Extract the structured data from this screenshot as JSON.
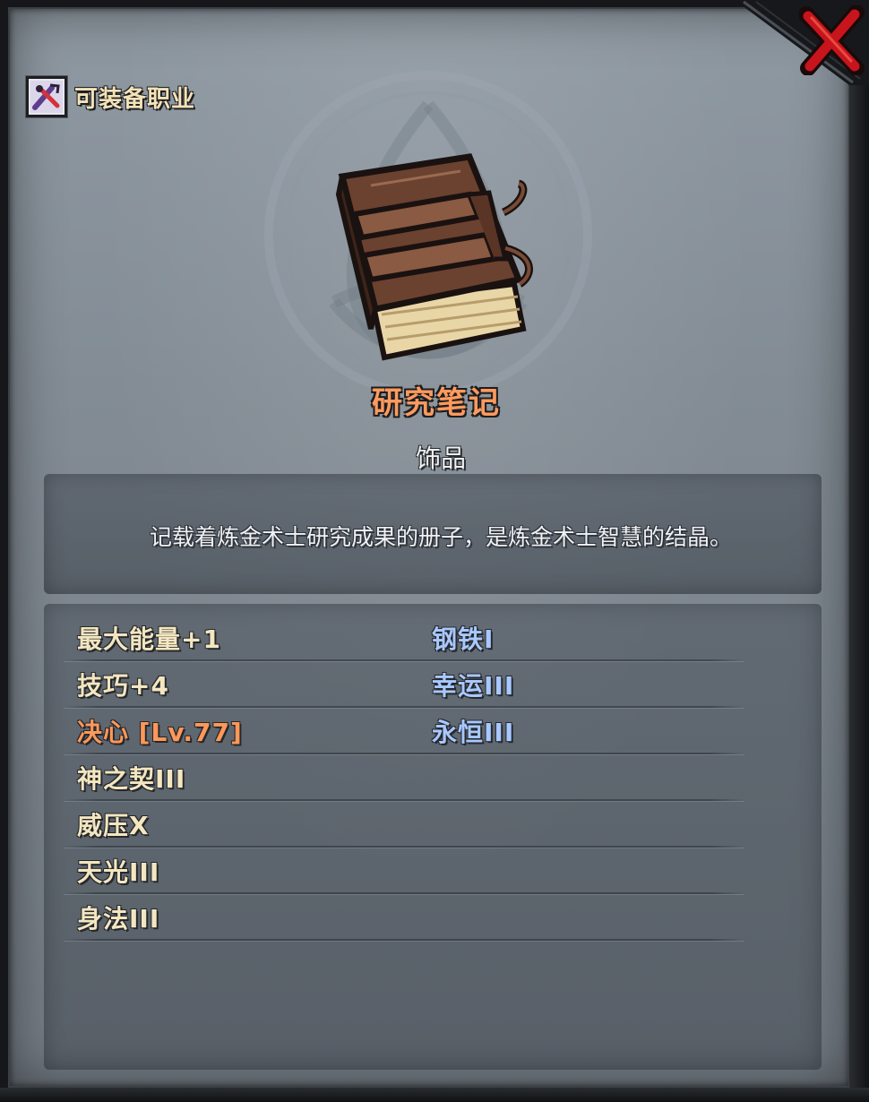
{
  "header": {
    "class_label": "可装备职业",
    "class_icon": "crossed-tools-icon"
  },
  "close_icon": "close-x-icon",
  "item": {
    "name": "研究笔记",
    "type": "饰品",
    "icon": "leather-book-icon",
    "description": "记载着炼金术士研究成果的册子，是炼金术士智慧的结晶。"
  },
  "stats": {
    "left": [
      {
        "text": "最大能量+1"
      },
      {
        "text": "技巧+4"
      },
      {
        "text": "决心 [Lv.77]"
      },
      {
        "text": "神之契III"
      },
      {
        "text": "威压X"
      },
      {
        "text": "天光III"
      },
      {
        "text": "身法III"
      }
    ],
    "right": [
      {
        "text": "钢铁I"
      },
      {
        "text": "幸运III"
      },
      {
        "text": "永恒III"
      }
    ]
  },
  "colors": {
    "item_name": "#ff9a5e",
    "highlight_stat": "#ff9858",
    "normal_stat": "#f3e6c0",
    "skill_stat": "#a8c8ff",
    "close_red": "#c8141c"
  }
}
